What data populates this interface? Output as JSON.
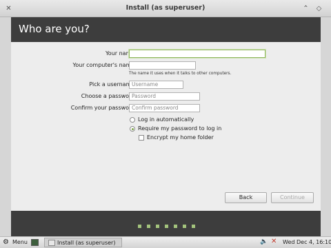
{
  "window": {
    "title": "Install (as superuser)"
  },
  "header": {
    "heading": "Who are you?"
  },
  "form": {
    "name_label": "Your name:",
    "name_value": "",
    "computer_label": "Your computer's name:",
    "computer_value": "",
    "computer_hint": "The name it uses when it talks to other computers.",
    "username_label": "Pick a username:",
    "username_placeholder": "Username",
    "password_label": "Choose a password:",
    "password_placeholder": "Password",
    "confirm_label": "Confirm your password:",
    "confirm_placeholder": "Confirm password",
    "login_auto_label": "Log in automatically",
    "require_password_label": "Require my password to log in",
    "encrypt_label": "Encrypt my home folder",
    "selected_login_option": "require_password"
  },
  "buttons": {
    "back": "Back",
    "continue": "Continue"
  },
  "progress": {
    "total_steps": 7
  },
  "taskbar": {
    "menu_label": "Menu",
    "task_label": "Install (as superuser)",
    "clock": "Wed Dec  4, 16:10"
  },
  "colors": {
    "header_bg": "#3d3d3d",
    "accent": "#8fb65f",
    "progress_dot": "#a4c47d"
  }
}
